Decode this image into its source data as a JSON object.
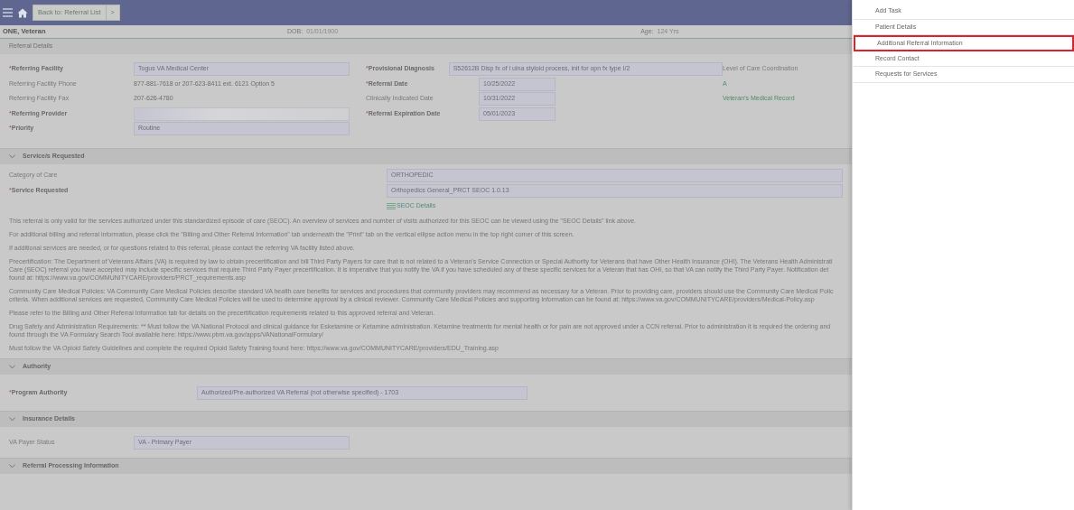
{
  "required_marker": "*",
  "top_bar": {
    "back_button": "Back to: Referral List",
    "next_button": ">"
  },
  "patient": {
    "name": "ONE, Veteran",
    "dob_label": "DOB:",
    "dob": "01/01/1900",
    "age_label": "Age:",
    "age": "124 Yrs"
  },
  "referral_details": {
    "title": "Referral Details",
    "left": [
      {
        "label": "Referring Facility",
        "required": true,
        "kind": "field",
        "value": "Togus VA Medical Center"
      },
      {
        "label": "Referring Facility Phone",
        "required": false,
        "kind": "text",
        "value": "877-881-7618 or 207-623-8411 ext. 6121 Option 5"
      },
      {
        "label": "Referring Facility Fax",
        "required": false,
        "kind": "text",
        "value": "207-626-4780"
      },
      {
        "label": "Referring Provider",
        "required": true,
        "kind": "redacted"
      },
      {
        "label": "Priority",
        "required": true,
        "kind": "field",
        "value": "Routine"
      }
    ],
    "middle": [
      {
        "label": "Provisional Diagnosis",
        "required": true,
        "kind": "wide",
        "value": "S52612B Disp fx of l ulna styloid process, init for opn fx type I/2"
      },
      {
        "label": "Referral Date",
        "required": true,
        "kind": "field",
        "value": "10/25/2022"
      },
      {
        "label": "Clinically Indicated Date",
        "required": false,
        "kind": "field",
        "value": "10/31/2022"
      },
      {
        "label": "Referral Expiration Date",
        "required": true,
        "kind": "field",
        "value": "05/01/2023"
      }
    ],
    "right": [
      {
        "kind": "label",
        "label": "Level of Care Coordination"
      },
      {
        "kind": "link",
        "label": "A"
      },
      {
        "kind": "link",
        "label": "Veteran's Medical Record"
      }
    ]
  },
  "services": {
    "title": "Service/s Requested",
    "expanded": true,
    "rows": [
      {
        "label": "Category of Care",
        "required": false,
        "value": "ORTHOPEDIC"
      },
      {
        "label": "Service Requested",
        "required": true,
        "value": "Orthopedics General_PRCT SEOC 1.0.13"
      }
    ],
    "link": "SEOC Details",
    "paragraphs": [
      {
        "lines": [
          "This referral is only valid for the services authorized under this standardized episode of care (SEOC). An overview of services and number of visits authorized for this SEOC can be viewed using the \"SEOC Details\" link above."
        ]
      },
      {
        "lines": [
          "For additional billing and referral information, please click the \"Billing and Other Referral Information\" tab underneath the \"Print\" tab on the vertical ellipse action menu in the top right corner of this screen."
        ]
      },
      {
        "lines": [
          "If additional services are needed, or for questions related to this referral, please contact the referring VA facility listed above."
        ]
      },
      {
        "lines": [
          "Precertification: The Department of Veterans Affairs (VA) is required by law to obtain precertification and bill Third Party Payers for care that is not related to a Veteran's Service Connection or Special Authority for Veterans that have Other Health Insurance (OHI). The Veterans Health Administrati",
          "Care (SEOC) referral you have accepted may include specific services that require Third Party Payer precertification.  It is imperative that you notify the VA if you have scheduled any of these specific services for a Veteran that has OHI, so that VA can notify the Third Party Payer.  Notification det",
          "found at: https://www.va.gov/COMMUNITYCARE/providers/PRCT_requirements.asp"
        ]
      },
      {
        "lines": [
          "Community Care Medical Policies: VA Community Care Medical Policies describe standard VA health care benefits for services and procedures that community providers may recommend as necessary for a Veteran. Prior to providing care, providers should use the Community Care Medical Polic",
          "criteria. When additional services are requested, Community Care Medical Policies will be used to determine approval by a clinical reviewer. Community Care Medical Policies and supporting information can be found at: https://www.va.gov/COMMUNITYCARE/providers/Medical-Policy.asp"
        ]
      },
      {
        "lines": [
          "Please refer to the Billing and Other Referral Information tab for details on the precertification requirements related to this approved referral and Veteran."
        ]
      },
      {
        "lines": [
          "Drug Safety and Administration Requirements: ** Must follow the VA National Protocol and clinical guidance for Esketamine or Ketamine administration. Ketamine treatments for mental health or for pain are not approved under a CCN referral. Prior to administration it is required the ordering and",
          "found through the VA Formulary Search Tool available here: https://www.pbm.va.gov/apps/VANationalFormulary/"
        ]
      },
      {
        "lines": [
          "Must follow the VA Opioid Safety Guidelines and complete the required Opioid Safety Training found here: https://www.va.gov/COMMUNITYCARE/providers/EDU_Training.asp"
        ]
      }
    ]
  },
  "authority": {
    "title": "Authority",
    "expanded": true,
    "label": "Program Authority",
    "required": true,
    "value": "Authorized/Pre-authorized VA Referral (not otherwise specified) - 1703"
  },
  "insurance": {
    "title": "Insurance Details",
    "expanded": true,
    "label": "VA Payer Status",
    "required": false,
    "value": "VA - Primary Payer"
  },
  "processing": {
    "title": "Referral Processing Information",
    "expanded": true
  },
  "action_menu": [
    {
      "label": "Add Task",
      "highlighted": false
    },
    {
      "label": "Patient Details",
      "highlighted": false
    },
    {
      "label": "Additional Referral Information",
      "highlighted": true
    },
    {
      "label": "Record Contact",
      "highlighted": false
    },
    {
      "label": "Requests for Services",
      "highlighted": false
    }
  ]
}
